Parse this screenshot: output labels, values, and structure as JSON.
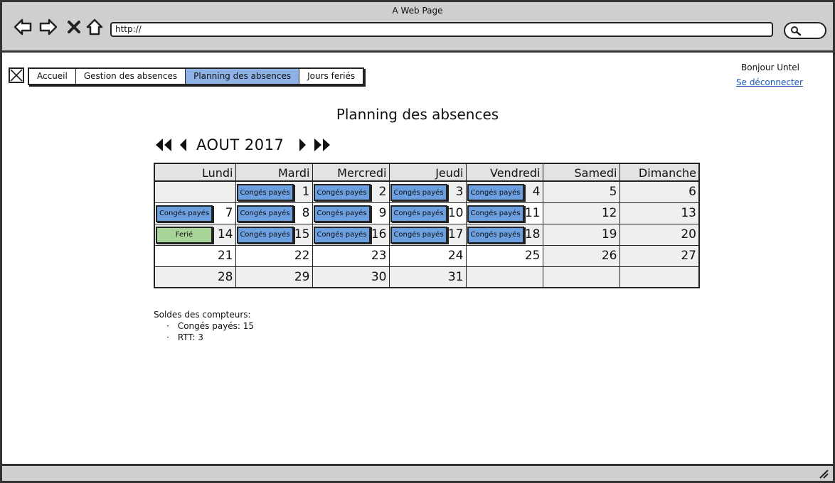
{
  "window": {
    "title": "A Web Page"
  },
  "browser": {
    "url": "http://"
  },
  "header": {
    "tabs": [
      {
        "label": "Accueil",
        "active": false
      },
      {
        "label": "Gestion des absences",
        "active": false
      },
      {
        "label": "Planning des absences",
        "active": true
      },
      {
        "label": "Jours feriés",
        "active": false
      }
    ],
    "greeting": "Bonjour Untel",
    "logout": "Se déconnecter"
  },
  "page": {
    "title": "Planning des absences"
  },
  "calendar": {
    "month_label": "AOUT 2017",
    "weekdays": [
      "Lundi",
      "Mardi",
      "Mercredi",
      "Jeudi",
      "Vendredi",
      "Samedi",
      "Dimanche"
    ],
    "weeks": [
      [
        {
          "day": ""
        },
        {
          "day": "1",
          "event": "Congés payés",
          "type": "blue"
        },
        {
          "day": "2",
          "event": "Congés payés",
          "type": "blue"
        },
        {
          "day": "3",
          "event": "Congés payés",
          "type": "blue"
        },
        {
          "day": "4",
          "event": "Congés payés",
          "type": "blue"
        },
        {
          "day": "5"
        },
        {
          "day": "6"
        }
      ],
      [
        {
          "day": "7",
          "event": "Congés payés",
          "type": "blue"
        },
        {
          "day": "8",
          "event": "Congés payés",
          "type": "blue"
        },
        {
          "day": "9",
          "event": "Congés payés",
          "type": "blue"
        },
        {
          "day": "10",
          "event": "Congés payés",
          "type": "blue"
        },
        {
          "day": "11",
          "event": "Congés payés",
          "type": "blue"
        },
        {
          "day": "12"
        },
        {
          "day": "13"
        }
      ],
      [
        {
          "day": "14",
          "event": "Ferié",
          "type": "green"
        },
        {
          "day": "15",
          "event": "Congés payés",
          "type": "blue"
        },
        {
          "day": "16",
          "event": "Congés payés",
          "type": "blue"
        },
        {
          "day": "17",
          "event": "Congés payés",
          "type": "blue"
        },
        {
          "day": "18",
          "event": "Congés payés",
          "type": "blue"
        },
        {
          "day": "19"
        },
        {
          "day": "20"
        }
      ],
      [
        {
          "day": "21"
        },
        {
          "day": "22"
        },
        {
          "day": "23"
        },
        {
          "day": "24"
        },
        {
          "day": "25"
        },
        {
          "day": "26"
        },
        {
          "day": "27"
        }
      ],
      [
        {
          "day": "28"
        },
        {
          "day": "29"
        },
        {
          "day": "30"
        },
        {
          "day": "31"
        },
        {
          "day": ""
        },
        {
          "day": ""
        },
        {
          "day": ""
        }
      ]
    ]
  },
  "counters": {
    "heading": "Soldes des compteurs:",
    "items": [
      "Congés payés: 15",
      "RTT: 3"
    ]
  },
  "colors": {
    "tab_active": "#8eb2e6",
    "leave_chip": "#6b9fe0",
    "holiday_chip": "#a8d49a",
    "link": "#1a56b8"
  }
}
